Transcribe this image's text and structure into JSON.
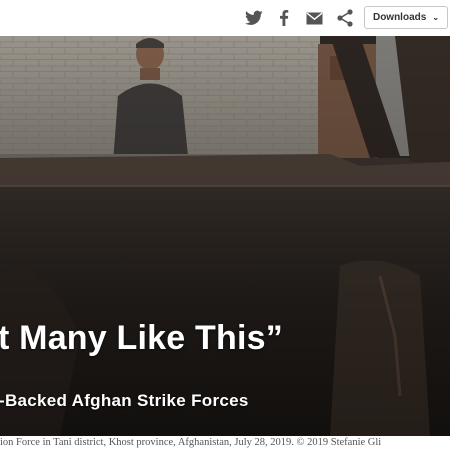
{
  "toolbar": {
    "icons": [
      "twitter-icon",
      "facebook-icon",
      "email-icon",
      "share-icon"
    ],
    "downloads_label": "Downloads",
    "downloads_chevron": "⌄"
  },
  "hero": {
    "title": "t Many Like This”",
    "subtitle": "-Backed Afghan Strike Forces"
  },
  "caption": "ion Force in Tani district, Khost province, Afghanistan, July 28, 2019. © 2019 Stefanie Gli"
}
